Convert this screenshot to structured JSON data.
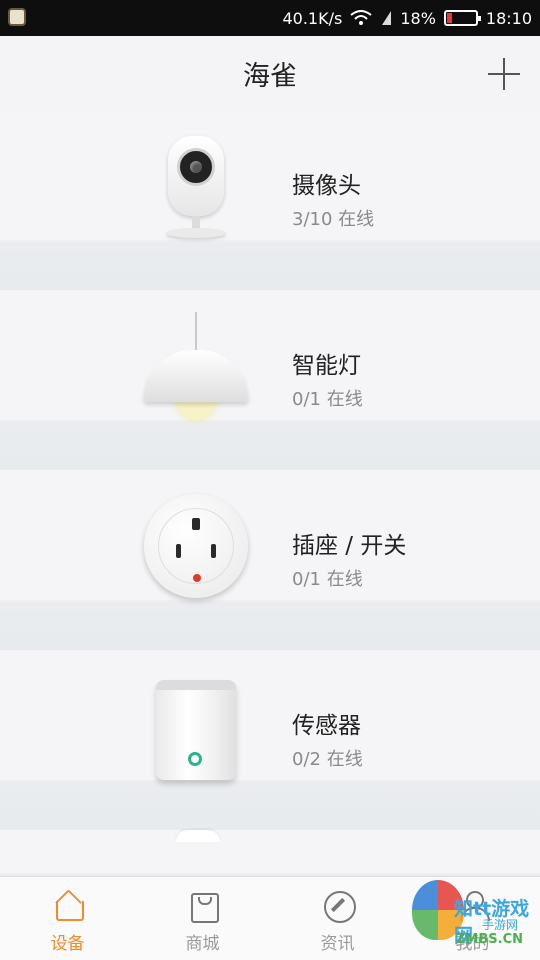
{
  "status_bar": {
    "network_speed": "40.1K/s",
    "battery_percent": "18%",
    "battery_level": 0.18,
    "time": "18:10",
    "icons": [
      "wifi-icon",
      "signal-icon",
      "battery-icon"
    ]
  },
  "header": {
    "title": "海雀",
    "add_icon": "plus-icon"
  },
  "devices": [
    {
      "name": "摄像头",
      "status": "3/10 在线",
      "icon": "camera-icon"
    },
    {
      "name": "智能灯",
      "status": "0/1 在线",
      "icon": "lamp-icon"
    },
    {
      "name": "插座 / 开关",
      "status": "0/1 在线",
      "icon": "socket-icon"
    },
    {
      "name": "传感器",
      "status": "0/2 在线",
      "icon": "sensor-icon"
    }
  ],
  "bottom_nav": {
    "items": [
      {
        "label": "设备",
        "icon": "home-icon",
        "active": true
      },
      {
        "label": "商城",
        "icon": "bag-icon",
        "active": false
      },
      {
        "label": "资讯",
        "icon": "compass-icon",
        "active": false
      },
      {
        "label": "我的",
        "icon": "user-icon",
        "active": false
      }
    ]
  },
  "watermark": {
    "line1": "知tt游戏网",
    "line2": "手游网",
    "line3": "ZMBS.CN"
  },
  "colors": {
    "accent": "#f08a2a",
    "status_bar_bg": "#0e0e0e",
    "page_bg": "#f4f4f6",
    "battery_low": "#e53935"
  }
}
